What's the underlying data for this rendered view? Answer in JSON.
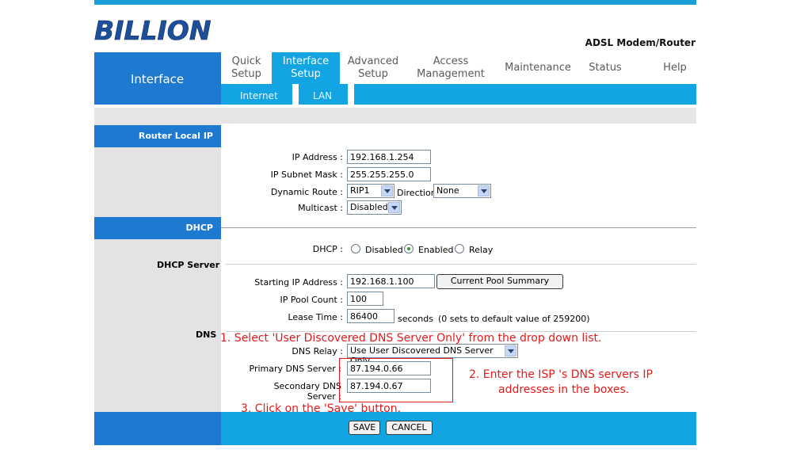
{
  "header": {
    "brand": "BILLION",
    "product": "ADSL Modem/Router",
    "section_title": "Interface"
  },
  "nav": {
    "tabs": [
      {
        "line1": "Quick",
        "line2": "Setup"
      },
      {
        "line1": "Interface",
        "line2": "Setup"
      },
      {
        "line1": "Advanced",
        "line2": "Setup"
      },
      {
        "line1": "Access",
        "line2": "Management"
      },
      {
        "line1": "Maintenance",
        "line2": ""
      },
      {
        "line1": "Status",
        "line2": ""
      },
      {
        "line1": "Help",
        "line2": ""
      }
    ],
    "subtabs": [
      "Internet",
      "LAN"
    ]
  },
  "router_local_ip": {
    "section_label": "Router Local IP",
    "ip_address_label": "IP Address :",
    "ip_address": "192.168.1.254",
    "subnet_label": "IP Subnet Mask :",
    "subnet": "255.255.255.0",
    "dynamic_route_label": "Dynamic Route :",
    "dynamic_route": "RIP1",
    "direction_label": "Direction",
    "direction": "None",
    "multicast_label": "Multicast :",
    "multicast": "Disabled"
  },
  "dhcp": {
    "section_label": "DHCP",
    "server_label": "DHCP Server",
    "dhcp_label": "DHCP :",
    "options": [
      "Disabled",
      "Enabled",
      "Relay"
    ],
    "selected": "Enabled",
    "start_ip_label": "Starting IP Address :",
    "start_ip": "192.168.1.100",
    "pool_button": "Current Pool Summary",
    "pool_count_label": "IP Pool Count :",
    "pool_count": "100",
    "lease_label": "Lease Time :",
    "lease": "86400",
    "lease_unit": "seconds",
    "lease_hint": "(0 sets to default value of 259200)"
  },
  "dns": {
    "section_label": "DNS",
    "relay_label": "DNS Relay :",
    "relay": "Use User Discovered DNS Server Only",
    "primary_label": "Primary DNS Server :",
    "primary": "87.194.0.66",
    "secondary_label": "Secondary DNS Server :",
    "secondary": "87.194.0.67"
  },
  "annotations": {
    "step1": "1. Select 'User Discovered DNS Server Only' from the drop down list.",
    "step2_line1": "2. Enter the ISP 's DNS servers IP",
    "step2_line2": "addresses in the boxes.",
    "step3": "3. Click on the 'Save' button."
  },
  "actions": {
    "save": "SAVE",
    "cancel": "CANCEL"
  },
  "colors": {
    "primary_blue": "#1e7ad1",
    "light_blue": "#13a4e3",
    "annotation_red": "#e31b1b"
  }
}
